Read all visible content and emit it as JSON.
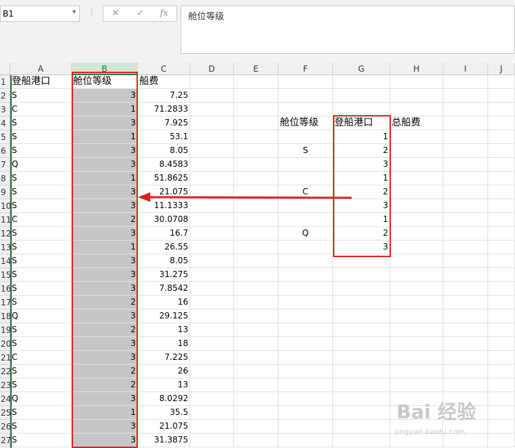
{
  "formula_bar": {
    "name_box": "B1",
    "formula": "舱位等级",
    "cancel_glyph": "✕",
    "confirm_glyph": "✓",
    "fx_glyph": "fx"
  },
  "columns": [
    "A",
    "B",
    "C",
    "D",
    "E",
    "F",
    "G",
    "H",
    "I",
    "J"
  ],
  "selected_column": "B",
  "row_numbers": [
    "1",
    "2",
    "3",
    "4",
    "5",
    "6",
    "7",
    "8",
    "9",
    "10",
    "11",
    "12",
    "13",
    "14",
    "15",
    "16",
    "17",
    "18",
    "19",
    "20",
    "21",
    "22",
    "23",
    "24",
    "25",
    "26",
    "27"
  ],
  "headers": {
    "a1": "登船港口",
    "b1": "舱位等级",
    "c1": "船费"
  },
  "rows": [
    {
      "a": "S",
      "b": "3",
      "c": "7.25"
    },
    {
      "a": "C",
      "b": "1",
      "c": "71.2833"
    },
    {
      "a": "S",
      "b": "3",
      "c": "7.925"
    },
    {
      "a": "S",
      "b": "1",
      "c": "53.1"
    },
    {
      "a": "S",
      "b": "3",
      "c": "8.05"
    },
    {
      "a": "Q",
      "b": "3",
      "c": "8.4583"
    },
    {
      "a": "S",
      "b": "1",
      "c": "51.8625"
    },
    {
      "a": "S",
      "b": "3",
      "c": "21.075"
    },
    {
      "a": "S",
      "b": "3",
      "c": "11.1333"
    },
    {
      "a": "C",
      "b": "2",
      "c": "30.0708"
    },
    {
      "a": "S",
      "b": "3",
      "c": "16.7"
    },
    {
      "a": "S",
      "b": "1",
      "c": "26.55"
    },
    {
      "a": "S",
      "b": "3",
      "c": "8.05"
    },
    {
      "a": "S",
      "b": "3",
      "c": "31.275"
    },
    {
      "a": "S",
      "b": "3",
      "c": "7.8542"
    },
    {
      "a": "S",
      "b": "2",
      "c": "16"
    },
    {
      "a": "Q",
      "b": "3",
      "c": "29.125"
    },
    {
      "a": "S",
      "b": "2",
      "c": "13"
    },
    {
      "a": "S",
      "b": "3",
      "c": "18"
    },
    {
      "a": "C",
      "b": "3",
      "c": "7.225"
    },
    {
      "a": "S",
      "b": "2",
      "c": "26"
    },
    {
      "a": "S",
      "b": "2",
      "c": "13"
    },
    {
      "a": "Q",
      "b": "3",
      "c": "8.0292"
    },
    {
      "a": "S",
      "b": "1",
      "c": "35.5"
    },
    {
      "a": "S",
      "b": "3",
      "c": "21.075"
    },
    {
      "a": "S",
      "b": "3",
      "c": "31.3875"
    }
  ],
  "summary": {
    "f4": "舱位等级",
    "g4": "登船港口",
    "h4": "总船费",
    "f_labels": [
      {
        "row": 6,
        "text": "S"
      },
      {
        "row": 9,
        "text": "C"
      },
      {
        "row": 12,
        "text": "Q"
      }
    ],
    "g_values": [
      "1",
      "2",
      "3",
      "1",
      "2",
      "3",
      "1",
      "2",
      "3"
    ]
  },
  "annotation_color": "#e02020",
  "watermark": {
    "line1": "Bai 经验",
    "line2": "jingyan.baidu.com"
  }
}
